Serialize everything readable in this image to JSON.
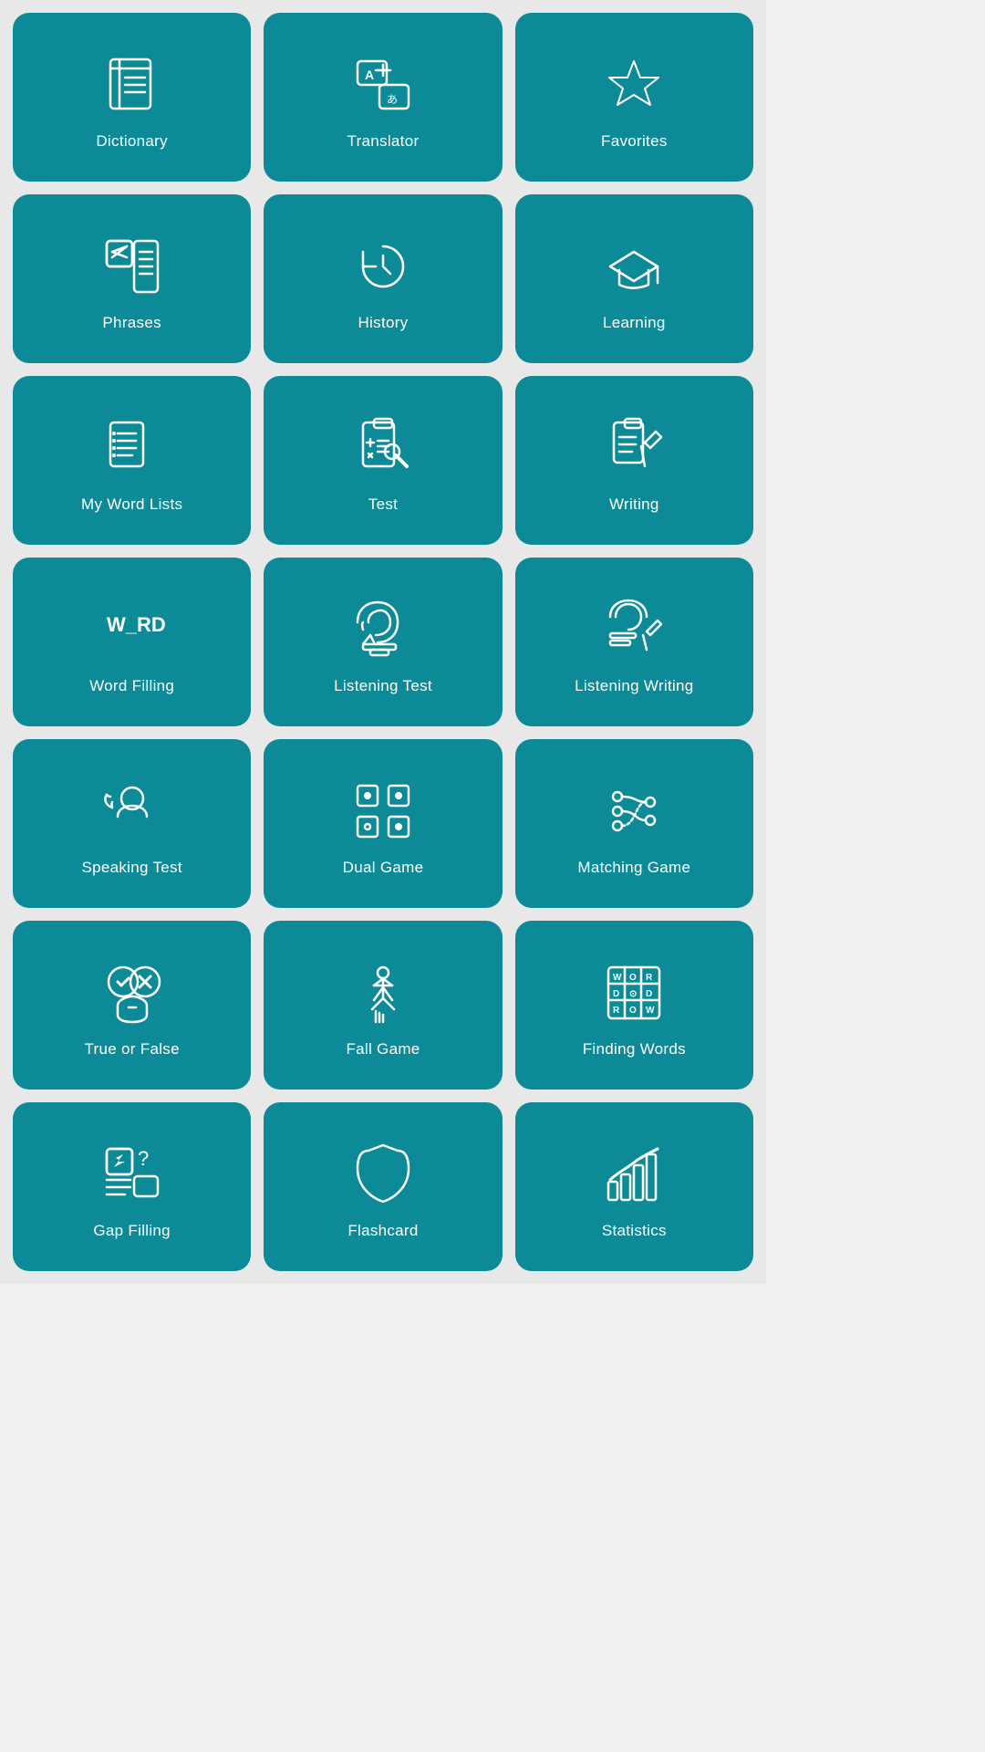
{
  "tiles": [
    {
      "id": "dictionary",
      "label": "Dictionary",
      "icon": "dictionary"
    },
    {
      "id": "translator",
      "label": "Translator",
      "icon": "translator"
    },
    {
      "id": "favorites",
      "label": "Favorites",
      "icon": "favorites"
    },
    {
      "id": "phrases",
      "label": "Phrases",
      "icon": "phrases"
    },
    {
      "id": "history",
      "label": "History",
      "icon": "history"
    },
    {
      "id": "learning",
      "label": "Learning",
      "icon": "learning"
    },
    {
      "id": "my-word-lists",
      "label": "My Word Lists",
      "icon": "wordlists"
    },
    {
      "id": "test",
      "label": "Test",
      "icon": "test"
    },
    {
      "id": "writing",
      "label": "Writing",
      "icon": "writing"
    },
    {
      "id": "word-filling",
      "label": "Word Filling",
      "icon": "wordfilling"
    },
    {
      "id": "listening-test",
      "label": "Listening Test",
      "icon": "listeningtest"
    },
    {
      "id": "listening-writing",
      "label": "Listening Writing",
      "icon": "listeningwriting"
    },
    {
      "id": "speaking-test",
      "label": "Speaking Test",
      "icon": "speakingtest"
    },
    {
      "id": "dual-game",
      "label": "Dual Game",
      "icon": "dualgame"
    },
    {
      "id": "matching-game",
      "label": "Matching Game",
      "icon": "matchinggame"
    },
    {
      "id": "true-or-false",
      "label": "True or False",
      "icon": "trueorfalse"
    },
    {
      "id": "fall-game",
      "label": "Fall Game",
      "icon": "fallgame"
    },
    {
      "id": "finding-words",
      "label": "Finding Words",
      "icon": "findingwords"
    },
    {
      "id": "gap-filling",
      "label": "Gap Filling",
      "icon": "gapfilling"
    },
    {
      "id": "flashcard",
      "label": "Flashcard",
      "icon": "flashcard"
    },
    {
      "id": "statistics",
      "label": "Statistics",
      "icon": "statistics"
    }
  ]
}
